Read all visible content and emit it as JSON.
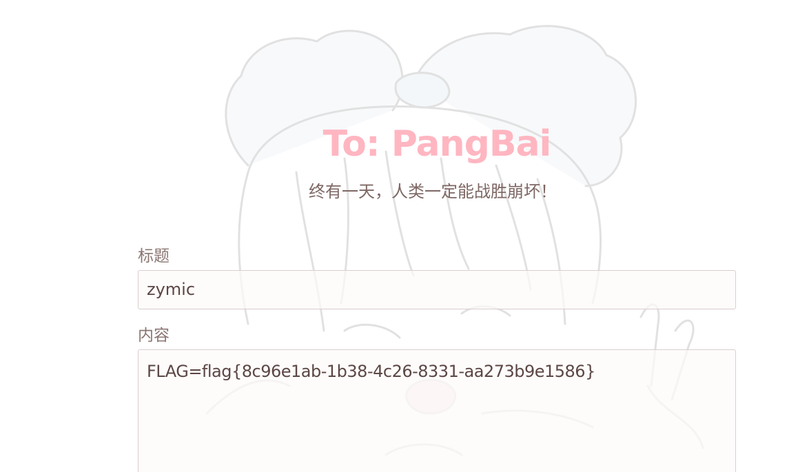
{
  "header": {
    "title": "To: PangBai",
    "subtitle": "终有一天，人类一定能战胜崩坏！"
  },
  "form": {
    "title_label": "标题",
    "title_value": "zymic",
    "content_label": "内容",
    "content_value": "FLAG=flag{8c96e1ab-1b38-4c26-8331-aa273b9e1586}"
  },
  "colors": {
    "title": "#ffb6c1",
    "subtitle": "#7d6763",
    "label": "#8a7672",
    "field_border": "#d8cfcd"
  },
  "background": {
    "image": "anime-girl-illustration"
  }
}
